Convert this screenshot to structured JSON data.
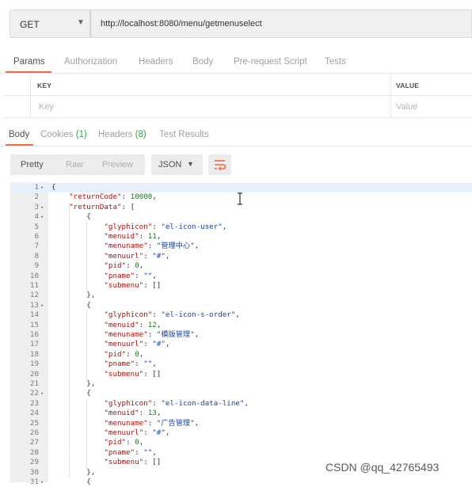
{
  "request": {
    "method": "GET",
    "url": "http://localhost:8080/menu/getmenuselect"
  },
  "request_tabs": [
    "Params",
    "Authorization",
    "Headers",
    "Body",
    "Pre-request Script",
    "Tests"
  ],
  "params_table": {
    "key_header": "KEY",
    "value_header": "VALUE",
    "key_placeholder": "Key",
    "value_placeholder": "Value"
  },
  "response_tabs": {
    "body": "Body",
    "cookies": "Cookies",
    "cookies_count": "(1)",
    "headers": "Headers",
    "headers_count": "(8)",
    "test_results": "Test Results"
  },
  "format_toolbar": {
    "pretty": "Pretty",
    "raw": "Raw",
    "preview": "Preview",
    "format": "JSON",
    "wrap_icon": "wrap-lines-icon",
    "caret_icon": "chevron-down-icon"
  },
  "code_lines": [
    {
      "n": "1",
      "fold": true
    },
    {
      "n": "2"
    },
    {
      "n": "3",
      "fold": true
    },
    {
      "n": "4",
      "fold": true
    },
    {
      "n": "5"
    },
    {
      "n": "6"
    },
    {
      "n": "7"
    },
    {
      "n": "8"
    },
    {
      "n": "9"
    },
    {
      "n": "10"
    },
    {
      "n": "11"
    },
    {
      "n": "12"
    },
    {
      "n": "13",
      "fold": true
    },
    {
      "n": "14"
    },
    {
      "n": "15"
    },
    {
      "n": "16"
    },
    {
      "n": "17"
    },
    {
      "n": "18"
    },
    {
      "n": "19"
    },
    {
      "n": "20"
    },
    {
      "n": "21"
    },
    {
      "n": "22",
      "fold": true
    },
    {
      "n": "23"
    },
    {
      "n": "24"
    },
    {
      "n": "25"
    },
    {
      "n": "26"
    },
    {
      "n": "27"
    },
    {
      "n": "28"
    },
    {
      "n": "29"
    },
    {
      "n": "30"
    },
    {
      "n": "31",
      "fold": true
    }
  ],
  "response": {
    "returnCode": "10000",
    "menus": [
      {
        "glyphicon": "el-icon-user",
        "menuid": "11",
        "menuname": "管理中心",
        "menuurl": "#",
        "pid": "0",
        "pname": "",
        "submenu": "[]"
      },
      {
        "glyphicon": "el-icon-s-order",
        "menuid": "12",
        "menuname": "模版管理",
        "menuurl": "#",
        "pid": "0",
        "pname": "",
        "submenu": "[]"
      },
      {
        "glyphicon": "el-icon-data-line",
        "menuid": "13",
        "menuname": "广告管理",
        "menuurl": "#",
        "pid": "0",
        "pname": "",
        "submenu": "[]"
      }
    ]
  },
  "watermark": "CSDN @qq_42765493"
}
